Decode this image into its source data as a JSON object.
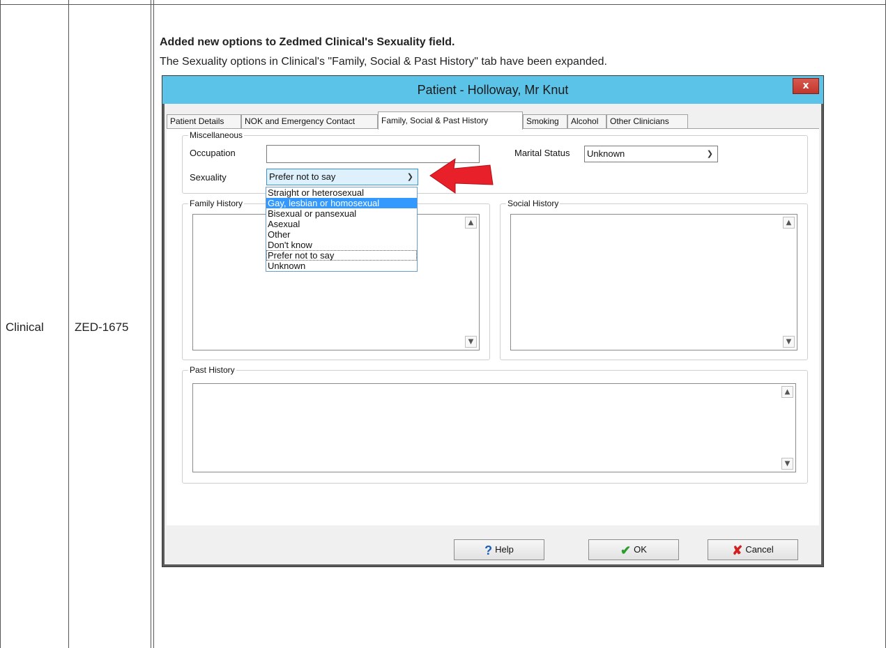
{
  "table": {
    "module": "Clinical",
    "ticket": "ZED-1675",
    "notes_title": "Added new options to Zedmed Clinical's Sexuality field.",
    "notes_body": "The Sexuality options in Clinical's \"Family, Social & Past History\" tab have been expanded."
  },
  "dialog": {
    "title": "Patient - Holloway, Mr Knut",
    "close_label": "x",
    "tabs": [
      {
        "label": "Patient Details"
      },
      {
        "label": "NOK and Emergency Contact"
      },
      {
        "label": "Family, Social & Past History"
      },
      {
        "label": "Smoking"
      },
      {
        "label": "Alcohol"
      },
      {
        "label": "Other Clinicians"
      }
    ],
    "active_tab": "Family, Social & Past History",
    "misc": {
      "legend": "Miscellaneous",
      "occupation_label": "Occupation",
      "occupation_value": "",
      "marital_label": "Marital Status",
      "marital_value": "Unknown",
      "sexuality_label": "Sexuality",
      "sexuality_value": "Prefer not to say"
    },
    "sexuality_options": [
      "Straight or heterosexual",
      "Gay, lesbian or homosexual",
      "Bisexual or pansexual",
      "Asexual",
      "Other",
      "Don't know",
      "Prefer not to say",
      "Unknown"
    ],
    "family_history": {
      "legend": "Family History",
      "value": ""
    },
    "social_history": {
      "legend": "Social History",
      "value": ""
    },
    "past_history": {
      "legend": "Past History",
      "value": ""
    },
    "buttons": {
      "help": "Help",
      "ok": "OK",
      "cancel": "Cancel"
    }
  },
  "colors": {
    "titlebar": "#5bc2e8",
    "highlight": "#3399ff",
    "arrow": "#e8202a"
  },
  "icons": {
    "help": "question-mark-icon",
    "ok": "checkmark-icon",
    "cancel": "x-icon"
  }
}
